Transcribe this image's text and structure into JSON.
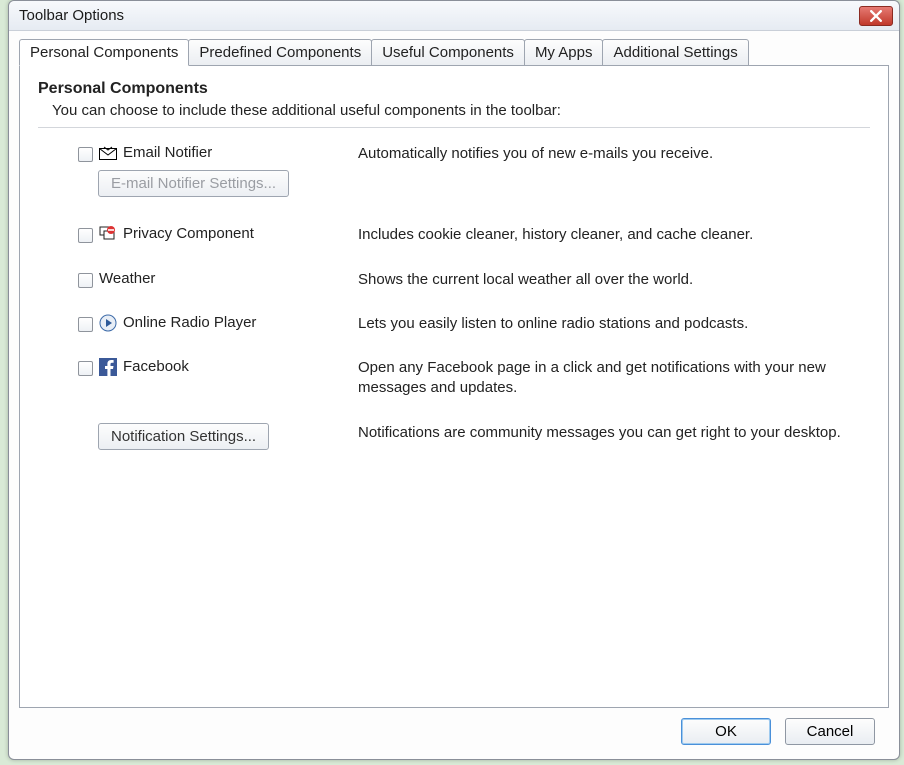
{
  "window": {
    "title": "Toolbar Options"
  },
  "tabs": [
    {
      "label": "Personal Components",
      "active": true
    },
    {
      "label": "Predefined Components"
    },
    {
      "label": "Useful Components"
    },
    {
      "label": "My Apps"
    },
    {
      "label": "Additional Settings"
    }
  ],
  "section": {
    "title": "Personal Components",
    "subtitle": "You can choose to include these additional useful components in the toolbar:"
  },
  "items": {
    "email": {
      "label": "Email Notifier",
      "description": "Automatically notifies you of new e-mails you receive.",
      "settings_button": "E-mail Notifier Settings..."
    },
    "privacy": {
      "label": "Privacy Component",
      "description": "Includes cookie cleaner, history cleaner, and cache cleaner."
    },
    "weather": {
      "label": "Weather",
      "description": "Shows the current local weather all over the world."
    },
    "radio": {
      "label": "Online Radio Player",
      "description": "Lets you easily listen to online radio stations and podcasts."
    },
    "facebook": {
      "label": "Facebook",
      "description": "Open any Facebook page in a click and get notifications with your new messages and updates."
    },
    "notifications": {
      "button": "Notification Settings...",
      "description": "Notifications are community messages you can get right to your desktop."
    }
  },
  "buttons": {
    "ok": "OK",
    "cancel": "Cancel"
  }
}
